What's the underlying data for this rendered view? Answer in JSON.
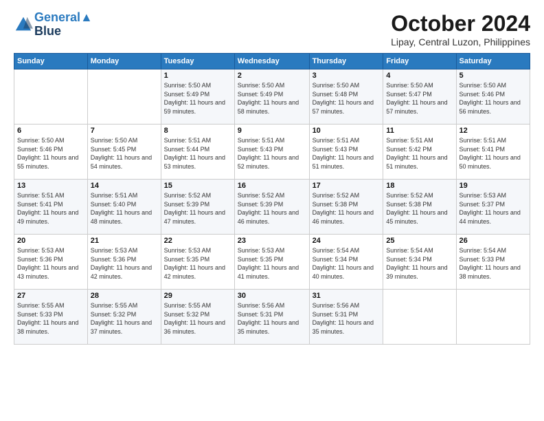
{
  "logo": {
    "line1": "General",
    "line2": "Blue"
  },
  "title": "October 2024",
  "location": "Lipay, Central Luzon, Philippines",
  "weekdays": [
    "Sunday",
    "Monday",
    "Tuesday",
    "Wednesday",
    "Thursday",
    "Friday",
    "Saturday"
  ],
  "weeks": [
    [
      {
        "day": "",
        "sunrise": "",
        "sunset": "",
        "daylight": ""
      },
      {
        "day": "",
        "sunrise": "",
        "sunset": "",
        "daylight": ""
      },
      {
        "day": "1",
        "sunrise": "Sunrise: 5:50 AM",
        "sunset": "Sunset: 5:49 PM",
        "daylight": "Daylight: 11 hours and 59 minutes."
      },
      {
        "day": "2",
        "sunrise": "Sunrise: 5:50 AM",
        "sunset": "Sunset: 5:49 PM",
        "daylight": "Daylight: 11 hours and 58 minutes."
      },
      {
        "day": "3",
        "sunrise": "Sunrise: 5:50 AM",
        "sunset": "Sunset: 5:48 PM",
        "daylight": "Daylight: 11 hours and 57 minutes."
      },
      {
        "day": "4",
        "sunrise": "Sunrise: 5:50 AM",
        "sunset": "Sunset: 5:47 PM",
        "daylight": "Daylight: 11 hours and 57 minutes."
      },
      {
        "day": "5",
        "sunrise": "Sunrise: 5:50 AM",
        "sunset": "Sunset: 5:46 PM",
        "daylight": "Daylight: 11 hours and 56 minutes."
      }
    ],
    [
      {
        "day": "6",
        "sunrise": "Sunrise: 5:50 AM",
        "sunset": "Sunset: 5:46 PM",
        "daylight": "Daylight: 11 hours and 55 minutes."
      },
      {
        "day": "7",
        "sunrise": "Sunrise: 5:50 AM",
        "sunset": "Sunset: 5:45 PM",
        "daylight": "Daylight: 11 hours and 54 minutes."
      },
      {
        "day": "8",
        "sunrise": "Sunrise: 5:51 AM",
        "sunset": "Sunset: 5:44 PM",
        "daylight": "Daylight: 11 hours and 53 minutes."
      },
      {
        "day": "9",
        "sunrise": "Sunrise: 5:51 AM",
        "sunset": "Sunset: 5:43 PM",
        "daylight": "Daylight: 11 hours and 52 minutes."
      },
      {
        "day": "10",
        "sunrise": "Sunrise: 5:51 AM",
        "sunset": "Sunset: 5:43 PM",
        "daylight": "Daylight: 11 hours and 51 minutes."
      },
      {
        "day": "11",
        "sunrise": "Sunrise: 5:51 AM",
        "sunset": "Sunset: 5:42 PM",
        "daylight": "Daylight: 11 hours and 51 minutes."
      },
      {
        "day": "12",
        "sunrise": "Sunrise: 5:51 AM",
        "sunset": "Sunset: 5:41 PM",
        "daylight": "Daylight: 11 hours and 50 minutes."
      }
    ],
    [
      {
        "day": "13",
        "sunrise": "Sunrise: 5:51 AM",
        "sunset": "Sunset: 5:41 PM",
        "daylight": "Daylight: 11 hours and 49 minutes."
      },
      {
        "day": "14",
        "sunrise": "Sunrise: 5:51 AM",
        "sunset": "Sunset: 5:40 PM",
        "daylight": "Daylight: 11 hours and 48 minutes."
      },
      {
        "day": "15",
        "sunrise": "Sunrise: 5:52 AM",
        "sunset": "Sunset: 5:39 PM",
        "daylight": "Daylight: 11 hours and 47 minutes."
      },
      {
        "day": "16",
        "sunrise": "Sunrise: 5:52 AM",
        "sunset": "Sunset: 5:39 PM",
        "daylight": "Daylight: 11 hours and 46 minutes."
      },
      {
        "day": "17",
        "sunrise": "Sunrise: 5:52 AM",
        "sunset": "Sunset: 5:38 PM",
        "daylight": "Daylight: 11 hours and 46 minutes."
      },
      {
        "day": "18",
        "sunrise": "Sunrise: 5:52 AM",
        "sunset": "Sunset: 5:38 PM",
        "daylight": "Daylight: 11 hours and 45 minutes."
      },
      {
        "day": "19",
        "sunrise": "Sunrise: 5:53 AM",
        "sunset": "Sunset: 5:37 PM",
        "daylight": "Daylight: 11 hours and 44 minutes."
      }
    ],
    [
      {
        "day": "20",
        "sunrise": "Sunrise: 5:53 AM",
        "sunset": "Sunset: 5:36 PM",
        "daylight": "Daylight: 11 hours and 43 minutes."
      },
      {
        "day": "21",
        "sunrise": "Sunrise: 5:53 AM",
        "sunset": "Sunset: 5:36 PM",
        "daylight": "Daylight: 11 hours and 42 minutes."
      },
      {
        "day": "22",
        "sunrise": "Sunrise: 5:53 AM",
        "sunset": "Sunset: 5:35 PM",
        "daylight": "Daylight: 11 hours and 42 minutes."
      },
      {
        "day": "23",
        "sunrise": "Sunrise: 5:53 AM",
        "sunset": "Sunset: 5:35 PM",
        "daylight": "Daylight: 11 hours and 41 minutes."
      },
      {
        "day": "24",
        "sunrise": "Sunrise: 5:54 AM",
        "sunset": "Sunset: 5:34 PM",
        "daylight": "Daylight: 11 hours and 40 minutes."
      },
      {
        "day": "25",
        "sunrise": "Sunrise: 5:54 AM",
        "sunset": "Sunset: 5:34 PM",
        "daylight": "Daylight: 11 hours and 39 minutes."
      },
      {
        "day": "26",
        "sunrise": "Sunrise: 5:54 AM",
        "sunset": "Sunset: 5:33 PM",
        "daylight": "Daylight: 11 hours and 38 minutes."
      }
    ],
    [
      {
        "day": "27",
        "sunrise": "Sunrise: 5:55 AM",
        "sunset": "Sunset: 5:33 PM",
        "daylight": "Daylight: 11 hours and 38 minutes."
      },
      {
        "day": "28",
        "sunrise": "Sunrise: 5:55 AM",
        "sunset": "Sunset: 5:32 PM",
        "daylight": "Daylight: 11 hours and 37 minutes."
      },
      {
        "day": "29",
        "sunrise": "Sunrise: 5:55 AM",
        "sunset": "Sunset: 5:32 PM",
        "daylight": "Daylight: 11 hours and 36 minutes."
      },
      {
        "day": "30",
        "sunrise": "Sunrise: 5:56 AM",
        "sunset": "Sunset: 5:31 PM",
        "daylight": "Daylight: 11 hours and 35 minutes."
      },
      {
        "day": "31",
        "sunrise": "Sunrise: 5:56 AM",
        "sunset": "Sunset: 5:31 PM",
        "daylight": "Daylight: 11 hours and 35 minutes."
      },
      {
        "day": "",
        "sunrise": "",
        "sunset": "",
        "daylight": ""
      },
      {
        "day": "",
        "sunrise": "",
        "sunset": "",
        "daylight": ""
      }
    ]
  ]
}
